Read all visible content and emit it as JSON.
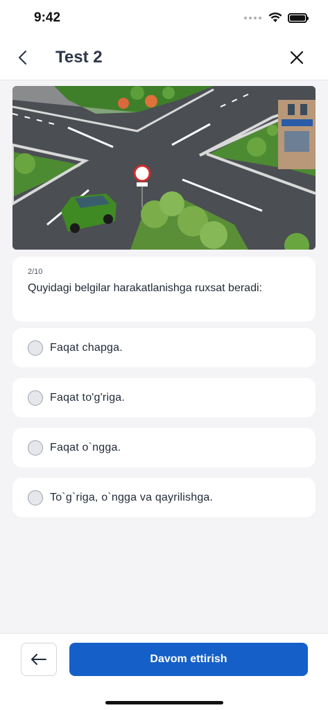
{
  "status_bar": {
    "time": "9:42",
    "icons": [
      "signal-dots-icon",
      "wifi-icon",
      "battery-icon"
    ]
  },
  "header": {
    "title": "Test 2",
    "back_icon": "chevron-left-icon",
    "close_icon": "close-icon"
  },
  "question": {
    "counter": "2/10",
    "text": "Quyidagi belgilar harakatlanishga ruxsat beradi:",
    "image_description": "traffic-intersection-scene"
  },
  "options": [
    {
      "label": "Faqat chapga.",
      "selected": false
    },
    {
      "label": "Faqat to'g'riga.",
      "selected": false
    },
    {
      "label": "Faqat o`ngga.",
      "selected": false
    },
    {
      "label": "To`g`riga, o`ngga va qayrilishga.",
      "selected": false
    }
  ],
  "footer": {
    "prev_icon": "arrow-left-icon",
    "next_label": "Davom ettirish"
  },
  "colors": {
    "primary": "#1560c8",
    "background": "#f4f4f6",
    "card": "#ffffff"
  }
}
